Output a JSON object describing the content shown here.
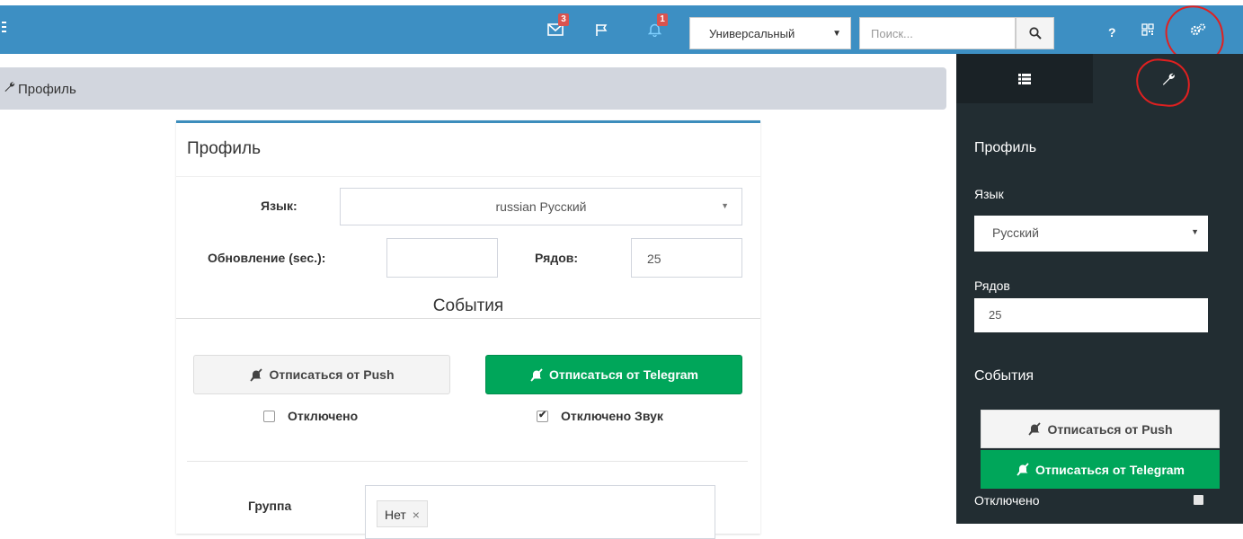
{
  "navbar": {
    "mail_badge": "3",
    "alerts_badge": "1",
    "theme_value": "Универсальный",
    "search_placeholder": "Поиск...",
    "help_label": "?"
  },
  "breadcrumb": {
    "label": "Профиль"
  },
  "profile_panel": {
    "title": "Профиль",
    "language_label": "Язык:",
    "language_value": "russian Русский",
    "refresh_label": "Обновление (sec.):",
    "refresh_value": "",
    "rows_label": "Рядов:",
    "rows_value": "25",
    "events_title": "События",
    "unsubscribe_push_label": "Отписаться от Push",
    "unsubscribe_telegram_label": "Отписаться от Telegram",
    "push_disabled_label": "Отключено",
    "push_disabled_checked": false,
    "telegram_disabled_sound_label": "Отключено Звук",
    "telegram_disabled_sound_checked": true,
    "group_label": "Группа",
    "group_tag": "Нет",
    "group_tag_remove": "×"
  },
  "sidebar": {
    "profile_title": "Профиль",
    "language_label": "Язык",
    "language_value": "Русский",
    "rows_label": "Рядов",
    "rows_value": "25",
    "events_title": "События",
    "unsubscribe_push_label": "Отписаться от Push",
    "unsubscribe_telegram_label": "Отписаться от Telegram",
    "disabled_label": "Отключено"
  },
  "colors": {
    "navbar": "#3d8fc3",
    "sidebar": "#222d32",
    "success": "#00a65a",
    "annotation": "#e02020"
  }
}
